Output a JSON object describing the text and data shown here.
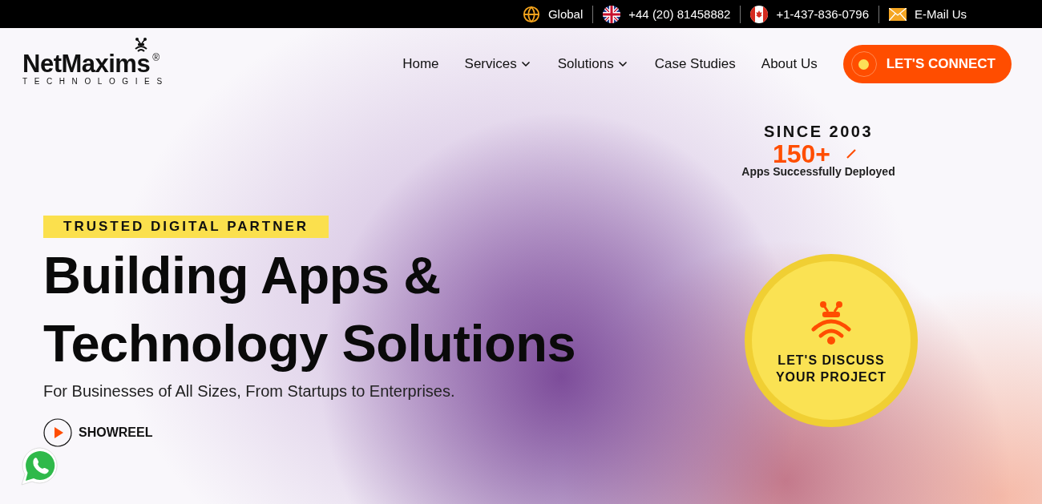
{
  "top_bar": {
    "items": [
      {
        "kind": "globe",
        "label": "Global"
      },
      {
        "kind": "uk",
        "label": "+44 (20) 81458882"
      },
      {
        "kind": "canada",
        "label": "+1-437-836-0796"
      },
      {
        "kind": "mail",
        "label": "E-Mail Us"
      }
    ]
  },
  "header": {
    "logo": {
      "name": "NetMaxims",
      "mark": "®",
      "tagline": "TECHNOLOGIES"
    },
    "nav": [
      {
        "label": "Home",
        "dropdown": false
      },
      {
        "label": "Services",
        "dropdown": true
      },
      {
        "label": "Solutions",
        "dropdown": true
      },
      {
        "label": "Case Studies",
        "dropdown": false
      },
      {
        "label": "About Us",
        "dropdown": false
      }
    ],
    "cta": "LET'S CONNECT"
  },
  "stats": {
    "since": "SINCE 2003",
    "count": "150+",
    "caption": "Apps Successfully Deployed"
  },
  "hero": {
    "badge": "TRUSTED DIGITAL PARTNER",
    "title_lines": [
      "Building Apps &",
      "Technology Solutions"
    ],
    "subtitle": "For Businesses of All Sizes, From Startups to Enterprises.",
    "showreel": "SHOWREEL"
  },
  "discuss": {
    "lines": [
      "LET'S DISCUSS",
      "YOUR PROJECT"
    ]
  }
}
